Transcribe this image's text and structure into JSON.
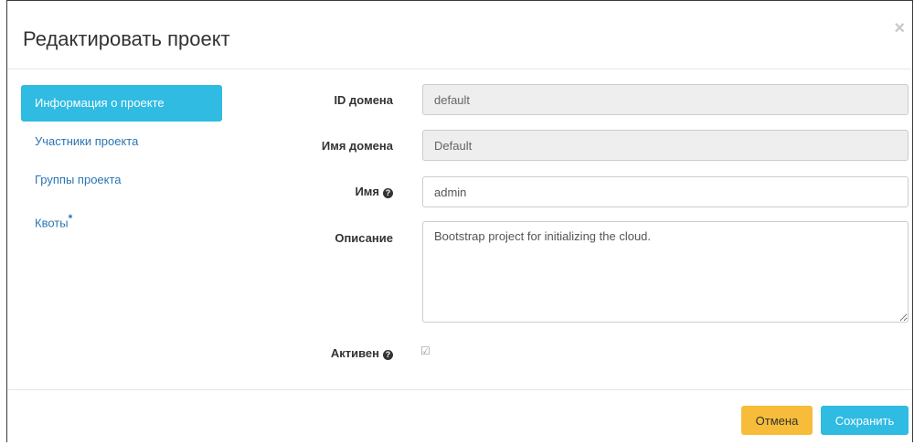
{
  "dialog": {
    "title": "Редактировать проект",
    "close_glyph": "×"
  },
  "nav": {
    "items": [
      {
        "label": "Информация о проекте",
        "active": true
      },
      {
        "label": "Участники проекта",
        "active": false
      },
      {
        "label": "Группы проекта",
        "active": false
      },
      {
        "label": "Квоты",
        "active": false,
        "required_marker": "*"
      }
    ]
  },
  "form": {
    "domain_id": {
      "label": "ID домена",
      "value": "default"
    },
    "domain_name": {
      "label": "Имя домена",
      "value": "Default"
    },
    "name": {
      "label": "Имя",
      "value": "admin",
      "help_icon": "question-circle-icon"
    },
    "description": {
      "label": "Описание",
      "value": "Bootstrap project for initializing the cloud."
    },
    "active": {
      "label": "Активен",
      "checked": true,
      "help_icon": "question-circle-icon"
    }
  },
  "footer": {
    "cancel_label": "Отмена",
    "save_label": "Сохранить"
  },
  "colors": {
    "accent": "#2fbbe2",
    "warning": "#f7bd3a",
    "link": "#2a75b3"
  }
}
